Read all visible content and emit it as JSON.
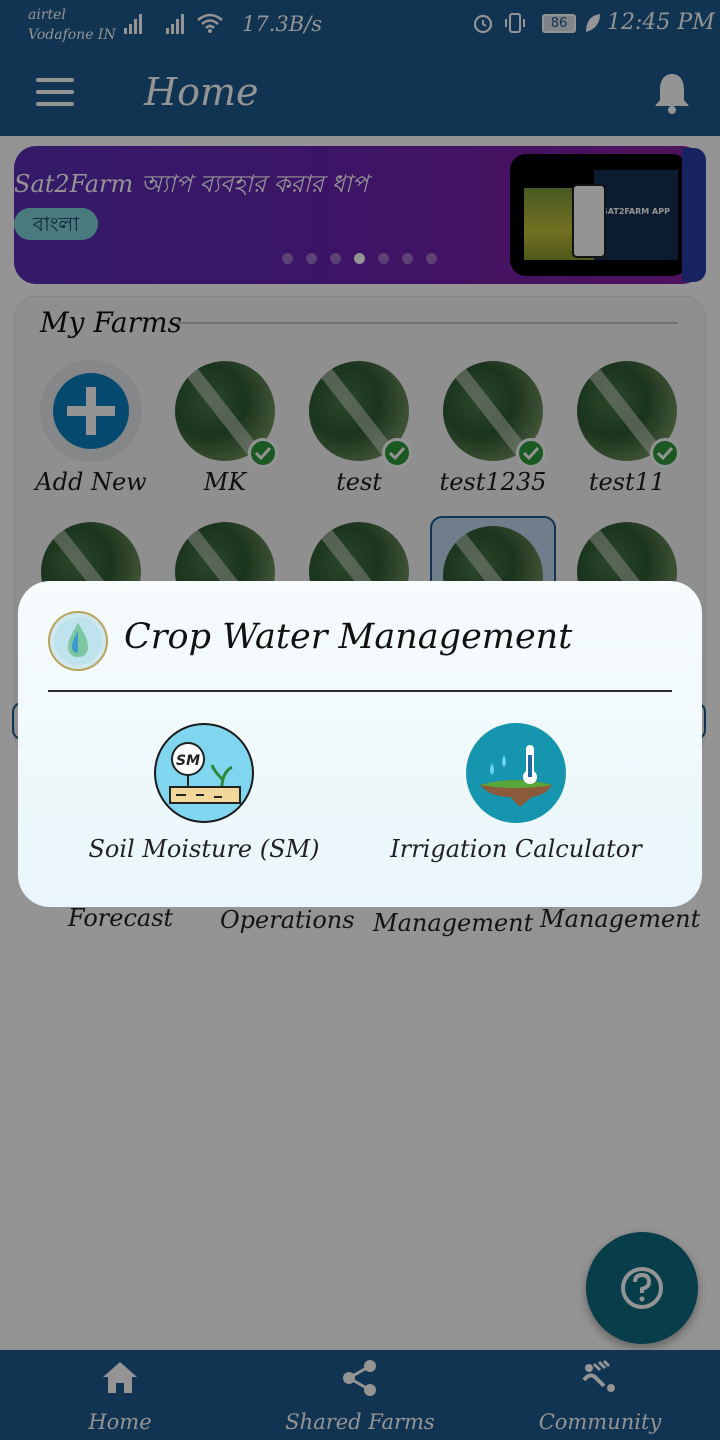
{
  "status_bar": {
    "carrier_1": "airtel",
    "carrier_2": "Vodafone IN",
    "net_speed": "17.3B/s",
    "battery": "86",
    "time": "12:45 PM"
  },
  "app_bar": {
    "title": "Home",
    "menu_icon": "hamburger-menu-icon",
    "notification_icon": "bell-icon"
  },
  "banner": {
    "title": "Sat2Farm অ্যাপ ব্যবহার করার ধাপ",
    "language_chip": "বাংলা",
    "video_text": "SAT2FARM APP"
  },
  "my_farms": {
    "heading": "My Farms",
    "add_new_label": "Add New",
    "farms": [
      {
        "name": "MK",
        "verified": true
      },
      {
        "name": "test",
        "verified": true
      },
      {
        "name": "test1235",
        "verified": true
      },
      {
        "name": "test11",
        "verified": true
      }
    ]
  },
  "background_features": [
    "Forecast",
    "Operations",
    "Management",
    "Management"
  ],
  "dialog": {
    "title": "Crop Water Management",
    "options": [
      {
        "label": "Soil Moisture (SM)",
        "icon": "soil-moisture-icon"
      },
      {
        "label": "Irrigation Calculator",
        "icon": "irrigation-calculator-icon"
      }
    ]
  },
  "fab": {
    "icon": "help-icon"
  },
  "bottom_nav": [
    {
      "label": "Home",
      "icon": "home-icon"
    },
    {
      "label": "Shared Farms",
      "icon": "share-icon"
    },
    {
      "label": "Community",
      "icon": "community-icon"
    }
  ],
  "colors": {
    "primary": "#1e5a8e",
    "banner_start": "#5a2eb5",
    "banner_end": "#8a1fa0",
    "accent_cyan": "#12a4b8",
    "verified_green": "#2d9a3a",
    "add_button_blue": "#0b7fc0",
    "fab": "#0f6a80"
  }
}
